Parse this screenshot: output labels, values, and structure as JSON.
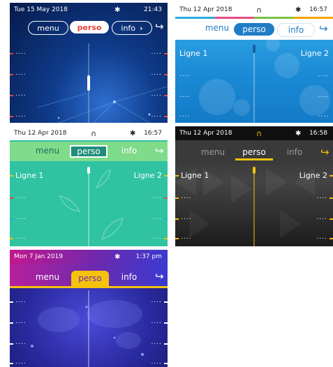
{
  "screens": [
    {
      "status": {
        "date": "Tue 15 May 2018",
        "time": "21:43",
        "bt_icon": "bluetooth-icon"
      },
      "tabs": {
        "menu": "menu",
        "perso": "perso",
        "info": "info",
        "chevron": "›"
      },
      "lignes": {
        "l1": "",
        "l2": ""
      },
      "theme": "dark-blue"
    },
    {
      "status": {
        "date": "Thu 12 Apr 2018",
        "time": "16:57",
        "bt_icon": "bluetooth-icon",
        "headset_icon": "headset-icon"
      },
      "tabs": {
        "menu": "menu",
        "perso": "perso",
        "info": "info"
      },
      "lignes": {
        "l1": "Ligne 1",
        "l2": "Ligne 2"
      },
      "theme": "light-blue"
    },
    {
      "status": {
        "date": "Thu 12 Apr 2018",
        "time": "16:57",
        "bt_icon": "bluetooth-icon",
        "headset_icon": "headset-icon"
      },
      "tabs": {
        "menu": "menu",
        "perso": "perso",
        "info": "info"
      },
      "lignes": {
        "l1": "Ligne 1",
        "l2": "Ligne 2"
      },
      "theme": "green"
    },
    {
      "status": {
        "date": "Thu 12 Apr 2018",
        "time": "16:58",
        "bt_icon": "bluetooth-icon",
        "headset_icon": "headset-icon"
      },
      "tabs": {
        "menu": "menu",
        "perso": "perso",
        "info": "info"
      },
      "lignes": {
        "l1": "Ligne 1",
        "l2": "Ligne 2"
      },
      "theme": "dark"
    },
    {
      "status": {
        "date": "Mon 7 Jan 2019",
        "time": "1:37 pm",
        "bt_icon": "bluetooth-icon"
      },
      "tabs": {
        "menu": "menu",
        "perso": "perso",
        "info": "info"
      },
      "lignes": {
        "l1": "",
        "l2": ""
      },
      "theme": "purple"
    }
  ],
  "symbols": {
    "dashes": "....",
    "bluetooth": "✱",
    "headset": "∩",
    "call": "↪"
  },
  "colors": {
    "red_accent": "#e8443a",
    "yellow_accent": "#f4c20d",
    "teal_tab": "#1f8d7b",
    "blue_tab": "#1f7cc6",
    "purple_bar": "#6a2ab0"
  }
}
